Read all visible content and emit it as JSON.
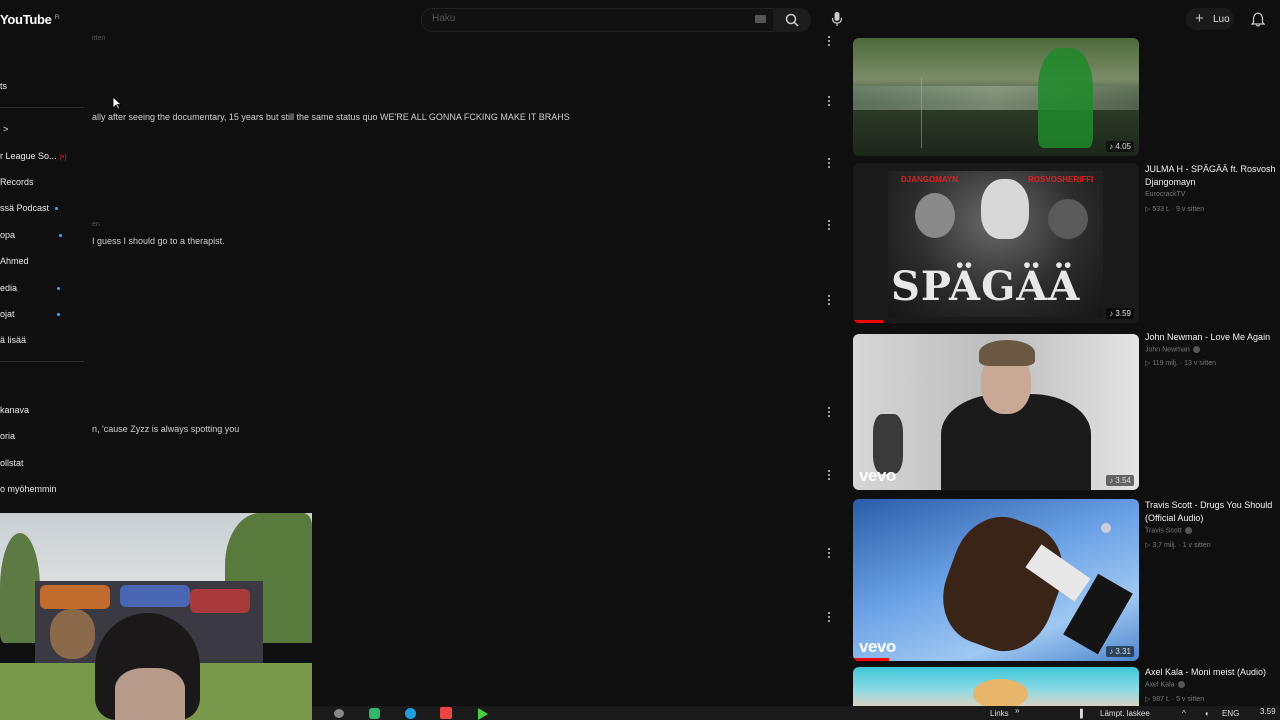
{
  "header": {
    "logo_text": "YouTube",
    "logo_region": "FI",
    "search_placeholder": "Haku",
    "create_label": "Luo"
  },
  "sidebar": {
    "items": [
      {
        "label": "ts",
        "dot": false
      },
      {
        "label": ">",
        "dot": false
      },
      {
        "label": "r League So...",
        "dot": false,
        "live": "(•)"
      },
      {
        "label": "Records",
        "dot": false
      },
      {
        "label": "ssä Podcast",
        "dot": true
      },
      {
        "label": "opa",
        "dot": true
      },
      {
        "label": "Ahmed",
        "dot": false
      },
      {
        "label": "edia",
        "dot": true
      },
      {
        "label": "ojat",
        "dot": true
      },
      {
        "label": "ä lisää",
        "dot": false
      },
      {
        "label": "kanava",
        "dot": false
      },
      {
        "label": "oria",
        "dot": false
      },
      {
        "label": "ollstat",
        "dot": false
      },
      {
        "label": "o myöhemmin",
        "dot": false
      }
    ]
  },
  "comments": [
    {
      "meta": "itten",
      "text": ""
    },
    {
      "meta": "",
      "text": "ally after seeing the documentary, 15 years but still the same status quo WE'RE ALL GONNA FCKING MAKE IT BRAHS"
    },
    {
      "meta": "en",
      "text": "I guess I should go to a therapist."
    },
    {
      "meta": "",
      "text": "n, 'cause Zyzz is always spotting you"
    }
  ],
  "recommended": [
    {
      "title": "",
      "channel": "",
      "views": "",
      "age": "",
      "duration": "4.05",
      "thumb_style": "lake"
    },
    {
      "title": "JULMA H - SPÄGÄÄ ft. Rosvosh",
      "title2": "Djangomayn",
      "channel": "EurocrackTV",
      "views": "533 t.",
      "age": "9 v sitten",
      "duration": "3.59",
      "thumb_style": "spagaa",
      "thumb_text": "SPÄGÄÄ",
      "thumb_left_text": "DJANGOMAYN",
      "thumb_right_text": "ROSVOSHERIFFI"
    },
    {
      "title": "John Newman - Love Me Again",
      "channel": "John Newman",
      "views": "119 milj.",
      "age": "13 v sitten",
      "duration": "3.54",
      "thumb_style": "vevo1",
      "thumb_text": "vevo"
    },
    {
      "title": "Travis Scott - Drugs You Should",
      "title2": "(Official Audio)",
      "channel": "Travis Scott",
      "views": "3,7 milj.",
      "age": "1 v sitten",
      "duration": "3.31",
      "thumb_style": "vevo2",
      "thumb_text": "vevo"
    },
    {
      "title": "Axel Kala - Moni meist (Audio)",
      "channel": "Axel Kala",
      "views": "987 t.",
      "age": "5 v sitten",
      "duration": "",
      "thumb_style": "axel"
    }
  ],
  "taskbar": {
    "weather": "Links",
    "chevron": "»",
    "sound": "Lämpt. laskee",
    "lang": "ENG",
    "time": "3.59"
  }
}
